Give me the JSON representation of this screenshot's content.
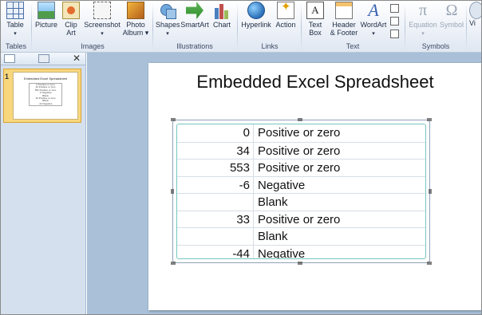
{
  "ribbon": {
    "buttons": [
      {
        "key": "table",
        "label1": "Table",
        "label2": "▾",
        "icon": "table-icon"
      },
      {
        "key": "picture",
        "label1": "Picture",
        "label2": "",
        "icon": "picture-icon"
      },
      {
        "key": "clipart",
        "label1": "Clip",
        "label2": "Art",
        "icon": "clip-art-icon"
      },
      {
        "key": "screenshot",
        "label1": "Screenshot",
        "label2": "▾",
        "icon": "screenshot-icon"
      },
      {
        "key": "photoalbum",
        "label1": "Photo",
        "label2": "Album ▾",
        "icon": "photo-album-icon"
      },
      {
        "key": "shapes",
        "label1": "Shapes",
        "label2": "▾",
        "icon": "shapes-icon"
      },
      {
        "key": "smartart",
        "label1": "SmartArt",
        "label2": "",
        "icon": "smartart-icon"
      },
      {
        "key": "chart",
        "label1": "Chart",
        "label2": "",
        "icon": "chart-icon"
      },
      {
        "key": "hyperlink",
        "label1": "Hyperlink",
        "label2": "",
        "icon": "hyperlink-icon"
      },
      {
        "key": "action",
        "label1": "Action",
        "label2": "",
        "icon": "action-icon"
      },
      {
        "key": "textbox",
        "label1": "Text",
        "label2": "Box",
        "icon": "text-box-icon"
      },
      {
        "key": "headerfooter",
        "label1": "Header",
        "label2": "& Footer",
        "icon": "header-footer-icon"
      },
      {
        "key": "wordart",
        "label1": "WordArt",
        "label2": "▾",
        "icon": "wordart-icon"
      },
      {
        "key": "equation",
        "label1": "Equation",
        "label2": "▾",
        "icon": "equation-icon"
      },
      {
        "key": "symbol",
        "label1": "Symbol",
        "label2": "",
        "icon": "symbol-icon"
      },
      {
        "key": "video",
        "label1": "Vi",
        "label2": "",
        "icon": "video-icon"
      }
    ],
    "groups": {
      "tables": "Tables",
      "images": "Images",
      "illustrations": "Illustrations",
      "links": "Links",
      "text": "Text",
      "symbols": "Symbols"
    },
    "icon_glyphs": {
      "textbox": "A",
      "wordart": "A",
      "equation": "π",
      "symbol": "Ω"
    }
  },
  "pane": {
    "slide_number": "1",
    "close": "✕"
  },
  "slide": {
    "title": "Embedded Excel Spreadsheet",
    "rows": [
      {
        "value": "0",
        "label": "Positive or zero"
      },
      {
        "value": "34",
        "label": "Positive or zero"
      },
      {
        "value": "553",
        "label": "Positive or zero"
      },
      {
        "value": "-6",
        "label": "Negative"
      },
      {
        "value": "",
        "label": "Blank"
      },
      {
        "value": "33",
        "label": "Positive or zero"
      },
      {
        "value": "",
        "label": "Blank"
      },
      {
        "value": "-44",
        "label": "Negative"
      }
    ]
  }
}
